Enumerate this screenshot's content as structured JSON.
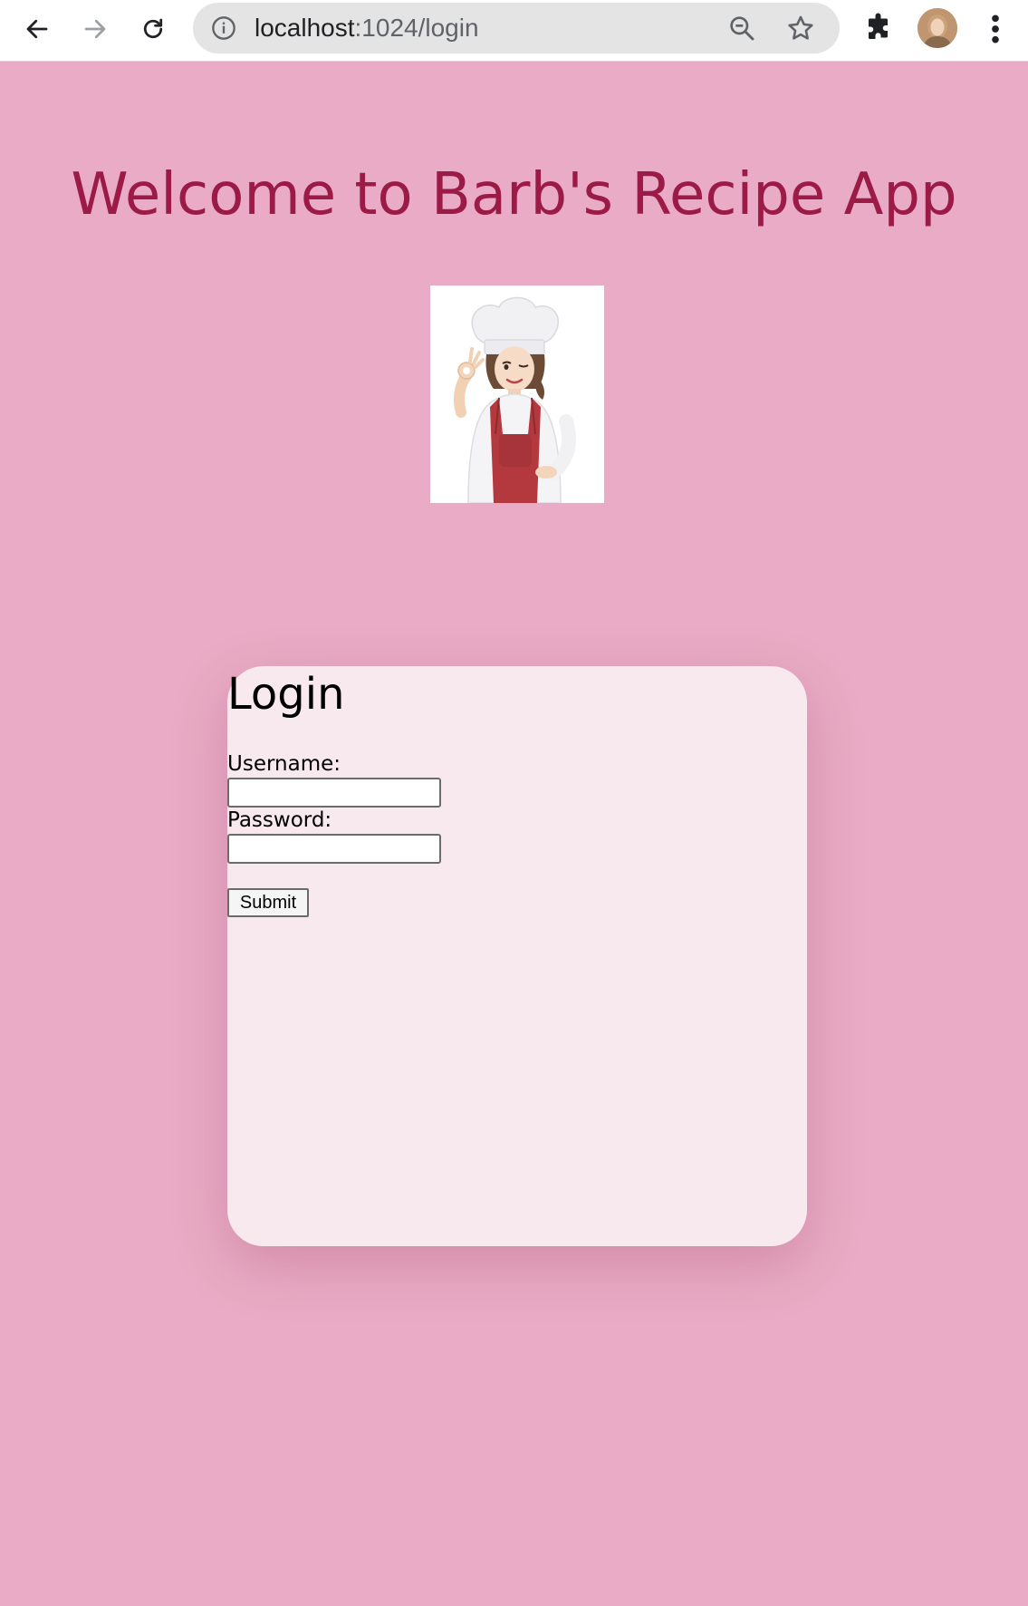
{
  "browser": {
    "url_host": "localhost",
    "url_path": ":1024/login"
  },
  "page": {
    "title": "Welcome to Barb's Recipe App",
    "hero_image": "chef-woman-illustration"
  },
  "login": {
    "heading": "Login",
    "username_label": "Username:",
    "username_value": "",
    "password_label": "Password:",
    "password_value": "",
    "submit_label": "Submit"
  },
  "colors": {
    "background": "#e9abc5",
    "title": "#9b1b46",
    "card": "#f8e9ef"
  }
}
